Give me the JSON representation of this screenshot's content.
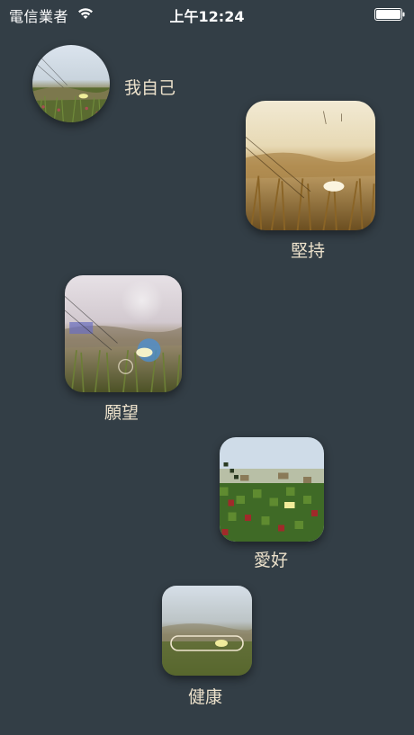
{
  "status_bar": {
    "carrier": "電信業者",
    "time": "上午12:24",
    "wifi_icon": "wifi-icon",
    "battery_icon": "battery-icon"
  },
  "items": [
    {
      "id": "self",
      "label": "我自己",
      "image": "meadow-flower-photo-circle"
    },
    {
      "id": "persist",
      "label": "堅持",
      "image": "meadow-flower-photo-sepia"
    },
    {
      "id": "wish",
      "label": "願望",
      "image": "meadow-flower-photo-bokeh"
    },
    {
      "id": "hobby",
      "label": "愛好",
      "image": "meadow-flower-photo-pixelated"
    },
    {
      "id": "health",
      "label": "健康",
      "image": "meadow-flower-photo-blurred"
    }
  ],
  "colors": {
    "background": "#333e46",
    "label": "#ece1cb"
  }
}
